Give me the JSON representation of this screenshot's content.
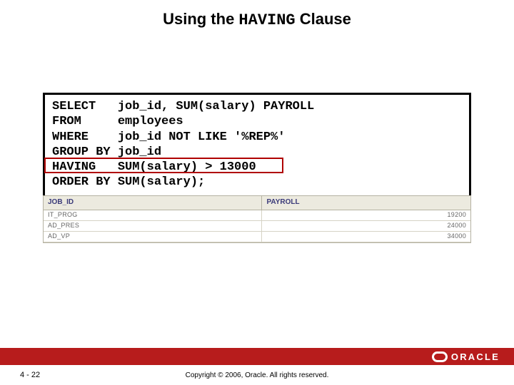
{
  "title_prefix": "Using the ",
  "title_mono": "HAVING",
  "title_suffix": " Clause",
  "sql_lines": [
    "SELECT   job_id, SUM(salary) PAYROLL",
    "FROM     employees",
    "WHERE    job_id NOT LIKE '%REP%'",
    "GROUP BY job_id",
    "HAVING   SUM(salary) > 13000",
    "ORDER BY SUM(salary);"
  ],
  "result": {
    "headers": [
      "JOB_ID",
      "PAYROLL"
    ],
    "rows": [
      [
        "IT_PROG",
        "19200"
      ],
      [
        "AD_PRES",
        "24000"
      ],
      [
        "AD_VP",
        "34000"
      ]
    ]
  },
  "page_num": "4 - 22",
  "copyright": "Copyright © 2006, Oracle. All rights reserved.",
  "oracle_word": "ORACLE",
  "chart_data": {
    "type": "table",
    "title": "Using the HAVING Clause",
    "columns": [
      "JOB_ID",
      "PAYROLL"
    ],
    "rows": [
      {
        "JOB_ID": "IT_PROG",
        "PAYROLL": 19200
      },
      {
        "JOB_ID": "AD_PRES",
        "PAYROLL": 24000
      },
      {
        "JOB_ID": "AD_VP",
        "PAYROLL": 34000
      }
    ]
  }
}
